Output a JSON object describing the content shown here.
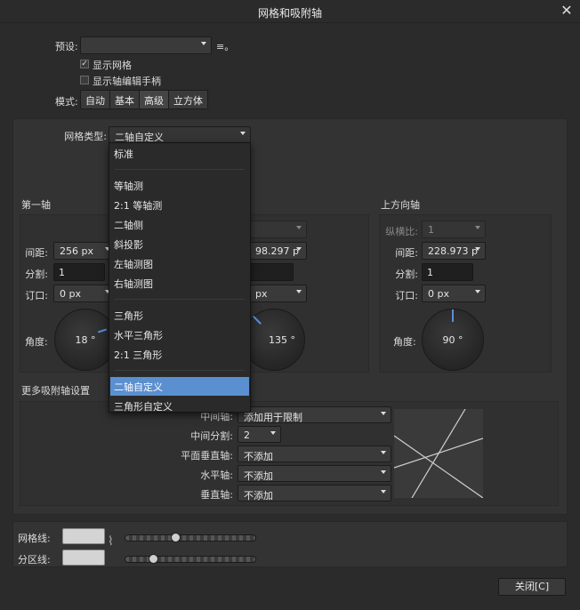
{
  "window": {
    "title": "网格和吸附轴",
    "close_icon": "close-icon"
  },
  "preset": {
    "label": "预设:",
    "value": "",
    "menu_icon": "≡。"
  },
  "options": {
    "show_grid": "显示网格",
    "show_grid_checked": true,
    "show_axis_handles": "显示轴编辑手柄",
    "show_axis_handles_checked": false
  },
  "mode": {
    "label": "模式:",
    "tabs": [
      "自动",
      "基本",
      "高级",
      "立方体"
    ],
    "active": "高级"
  },
  "grid_type": {
    "label": "网格类型:",
    "value": "二轴自定义"
  },
  "dropdown": {
    "groups": [
      [
        "标准"
      ],
      [
        "等轴测",
        "2:1 等轴测",
        "二轴侧",
        "斜投影",
        "左轴测图",
        "右轴测图"
      ],
      [
        "三角形",
        "水平三角形",
        "2:1 三角形"
      ],
      [
        "二轴自定义",
        "三角形自定义"
      ]
    ],
    "selected": "二轴自定义"
  },
  "axis1": {
    "title": "第一轴",
    "spacing_label": "间距:",
    "spacing": "256 px",
    "divisions_label": "分割:",
    "divisions": "1",
    "gutter_label": "订口:",
    "gutter": "0 px",
    "angle_label": "角度:",
    "angle": "18 °"
  },
  "axis2": {
    "spacing": "98.297 p",
    "gutter": "px",
    "angle": "135 °"
  },
  "up_axis": {
    "title": "上方向轴",
    "aspect_label": "纵横比:",
    "aspect": "1",
    "spacing_label": "间距:",
    "spacing": "228.973 p",
    "divisions_label": "分割:",
    "divisions": "1",
    "gutter_label": "订口:",
    "gutter": "0 px",
    "angle_label": "角度:",
    "angle": "90 °"
  },
  "snap": {
    "title": "更多吸附轴设置",
    "middle_label": "中间轴:",
    "middle": "添加用于限制",
    "middle_div_label": "中间分割:",
    "middle_div": "2",
    "plane_vert_label": "平面垂直轴:",
    "plane_vert": "不添加",
    "horiz_label": "水平轴:",
    "horiz": "不添加",
    "vert_label": "垂直轴:",
    "vert": "不添加"
  },
  "lines": {
    "grid_label": "网格线:",
    "sub_label": "分区线:",
    "grid_color": "#d4d4d4",
    "sub_color": "#d4d4d4",
    "grid_opacity": 0.38,
    "sub_opacity": 0.2
  },
  "footer": {
    "close": "关闭[C]"
  },
  "colors": {
    "accent": "#5a8fd0"
  }
}
